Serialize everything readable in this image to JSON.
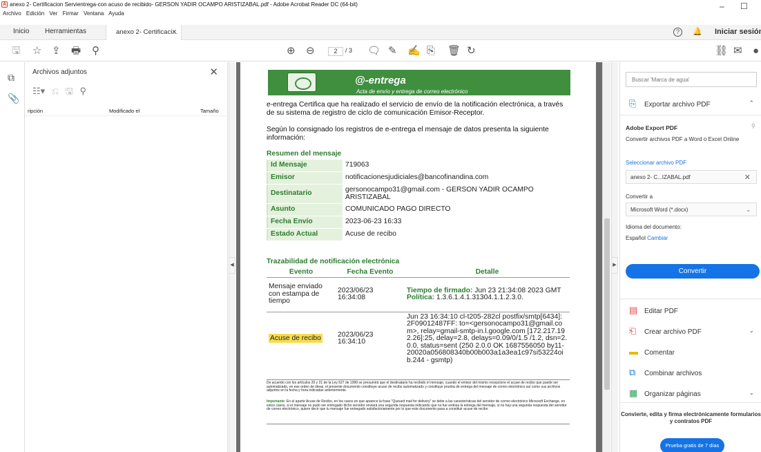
{
  "window": {
    "title": "anexo 2- Certificacion Servientrega-con acuso de recibido- GERSON YADIR OCAMPO ARISTIZABAL.pdf - Adobe Acrobat Reader DC (64-bit)",
    "menu": [
      "Archivo",
      "Edición",
      "Ver",
      "Firmar",
      "Ventana",
      "Ayuda"
    ]
  },
  "tabs": {
    "home": "Inicio",
    "tools": "Herramientas",
    "doc": "anexo 2- Certificaci...",
    "signin": "Iniciar sesión"
  },
  "toolbar": {
    "page_current": "2",
    "page_total": "/ 3"
  },
  "attachments": {
    "title": "Archivos adjuntos",
    "columns": [
      "ripción",
      "Modificado el",
      "Tamaño"
    ]
  },
  "document": {
    "banner_brand": "@-entrega",
    "banner_sub": "Acta de envío y entrega de correo electrónico",
    "intro": "e-entrega Certifica que ha realizado el servicio de envío de la notificación electrónica, a través de su sistema de registro de ciclo de comunicación Emisor-Receptor.",
    "intro2": "Según lo consignado los registros de e-entrega el mensaje de datos presenta la siguiente información:",
    "summary_title": "Resumen del mensaje",
    "summary": [
      {
        "k": "Id Mensaje",
        "v": "719063"
      },
      {
        "k": "Emisor",
        "v": "notificacionesjudiciales@bancofinandina.com"
      },
      {
        "k": "Destinatario",
        "v": "gersonocampo31@gmail.com - GERSON YADIR OCAMPO ARISTIZABAL"
      },
      {
        "k": "Asunto",
        "v": "COMUNICADO PAGO DIRECTO"
      },
      {
        "k": "Fecha Envío",
        "v": "2023-06-23 16:33"
      },
      {
        "k": "Estado Actual",
        "v": "Acuse de recibo"
      }
    ],
    "trace_title": "Trazabilidad de notificación electrónica",
    "trace_headers": [
      "Evento",
      "Fecha Evento",
      "Detalle"
    ],
    "trace_rows": [
      {
        "evento": "Mensaje enviado con estampa de tiempo",
        "fecha": "2023/06/23 16:34:08",
        "d1_label": "Tiempo de firmado:",
        "d1_value": " Jun 23 21:34:08 2023 GMT",
        "d2_label": "Política:",
        "d2_value": " 1.3.6.1.4.1.31304.1.1.2.3.0."
      },
      {
        "evento": "Acuse de recibo",
        "fecha": "2023/06/23 16:34:10",
        "detalle": "Jun 23 16:34:10 cl-t205-282cl postfix/smtp[6434]: 2F09012487FF: to=<gersonocampo31@gmail.com>, relay=gmail-smtp-in.l.google.com [172.217.192.26]:25, delay=2.8, delays=0.09/0/1.5 /1.2, dsn=2.0.0, status=sent (250 2.0.0 OK 1687556050 by11-20020a056808340b00b003a1a3ea1c97si53224oib.244 - gsmtp)"
      }
    ],
    "fine1": "De acuerdo con los artículos 20 y 21 de la Ley 527 de 1999 se presumirá que el destinatario ha recibido el mensaje, cuando el emisor del mismo recepcione el acuse de recibo que puede ser automatizado, en ese orden de ideas, el presente documento constituye acuse de recibo automatizado y constituye prueba de entrega del mensaje de correo electrónico así como sus archivos adjuntos en la fecha y hora indicadas anteriormente.",
    "fine2_label": "Importante:",
    "fine2": " En el aparte Acuse de Recibo, en los casos en que aparece la frase \"Queued mail for delivery\" se debe a las características del servidor de correo electrónico Microsoft Exchange, en estos casos, si el mensaje no pudo ser entregado dicho servidor enviará una segunda respuesta indicando que no fue exitosa la entrega del mensaje, si no hay una segunda respuesta del servidor de correo electrónico, quiere decir que tu mensaje fue entregado satisfactoriamente por lo que este documento pasa a constituir acuse de recibo"
  },
  "rightpanel": {
    "search_placeholder": "Buscar 'Marca de agua'",
    "export_title": "Exportar archivo PDF",
    "export_heading": "Adobe Export PDF",
    "export_desc": "Convertir archivos PDF a Word o Excel Online",
    "select_link": "Seleccionar archivo PDF",
    "file_name": "anexo 2- C...IZABAL.pdf",
    "convert_to_label": "Convertir a",
    "convert_to_value": "Microsoft Word (*.docx)",
    "lang_label": "Idioma del documento:",
    "lang_value": "Español",
    "lang_change": "Cambiar",
    "convert_button": "Convertir",
    "tools": [
      "Editar PDF",
      "Crear archivo PDF",
      "Comentar",
      "Combinar archivos",
      "Organizar páginas"
    ],
    "promo": "Convierte, edita y firma electrónicamente formularios y contratos PDF",
    "trial": "Prueba gratis de 7 días"
  },
  "colors": {
    "accent": "#1473e6",
    "doc_green": "#2e7d32",
    "highlight": "#f7dd4f"
  }
}
